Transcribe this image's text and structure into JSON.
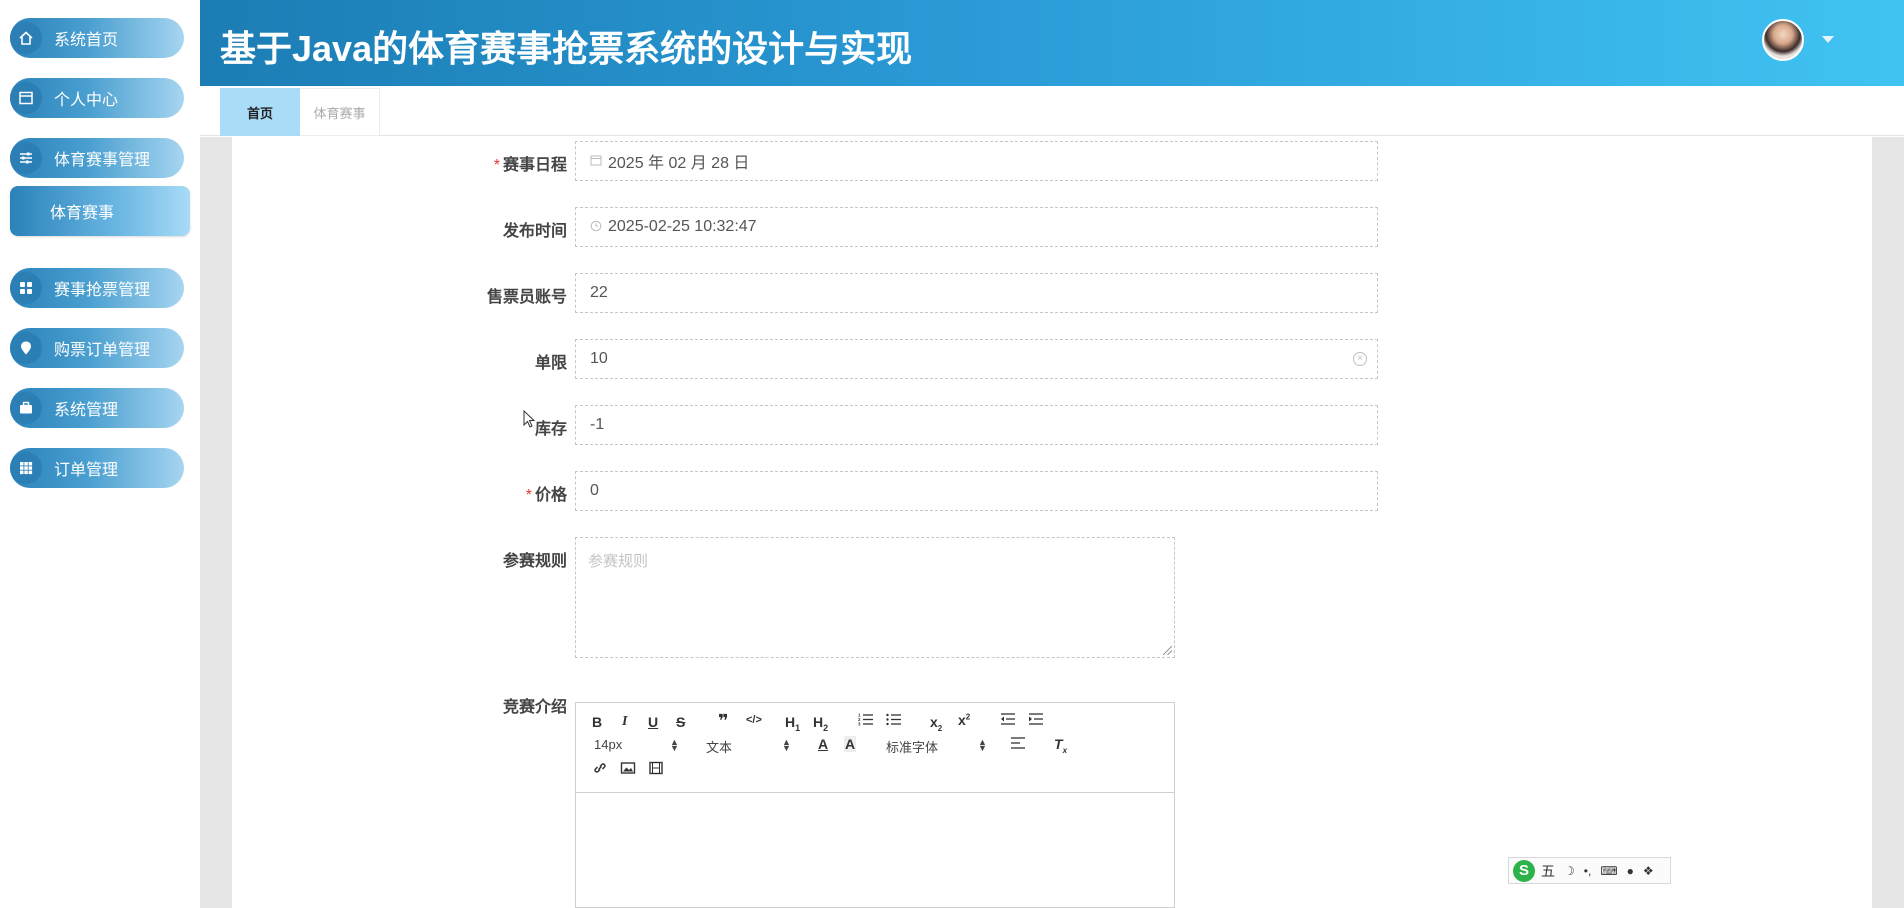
{
  "app": {
    "title": "基于Java的体育赛事抢票系统的设计与实现"
  },
  "sidebar": {
    "items": [
      {
        "label": "系统首页",
        "icon": "home-icon"
      },
      {
        "label": "个人中心",
        "icon": "profile-card-icon"
      },
      {
        "label": "体育赛事管理",
        "icon": "sliders-icon"
      },
      {
        "label": "赛事抢票管理",
        "icon": "grid-four-icon"
      },
      {
        "label": "购票订单管理",
        "icon": "location-pin-icon"
      },
      {
        "label": "系统管理",
        "icon": "briefcase-icon"
      },
      {
        "label": "订单管理",
        "icon": "apps-grid-icon"
      }
    ],
    "sub_item": {
      "label": "体育赛事"
    }
  },
  "tabs": [
    {
      "label": "首页",
      "active": true
    },
    {
      "label": "体育赛事",
      "active": false
    }
  ],
  "form": {
    "schedule": {
      "label": "赛事日程",
      "required": true,
      "value": "2025 年 02 月 28 日"
    },
    "publish_time": {
      "label": "发布时间",
      "value": "2025-02-25 10:32:47"
    },
    "seller_account": {
      "label": "售票员账号",
      "value": "22"
    },
    "limit": {
      "label": "单限",
      "value": "10"
    },
    "stock": {
      "label": "库存",
      "value": "-1"
    },
    "price": {
      "label": "价格",
      "required": true,
      "value": "0"
    },
    "rules": {
      "label": "参赛规则",
      "placeholder": "参赛规则"
    },
    "intro": {
      "label": "竞赛介绍"
    }
  },
  "editor": {
    "font_size": "14px",
    "block_format": "文本",
    "font_family": "标准字体"
  },
  "ime": {
    "mode_label": "五"
  },
  "colors": {
    "header_start": "#1c7db4",
    "header_end": "#40c3f2",
    "required_mark": "#e53935",
    "active_tab": "#a9dcf7",
    "ime_logo": "#2eb34a"
  }
}
